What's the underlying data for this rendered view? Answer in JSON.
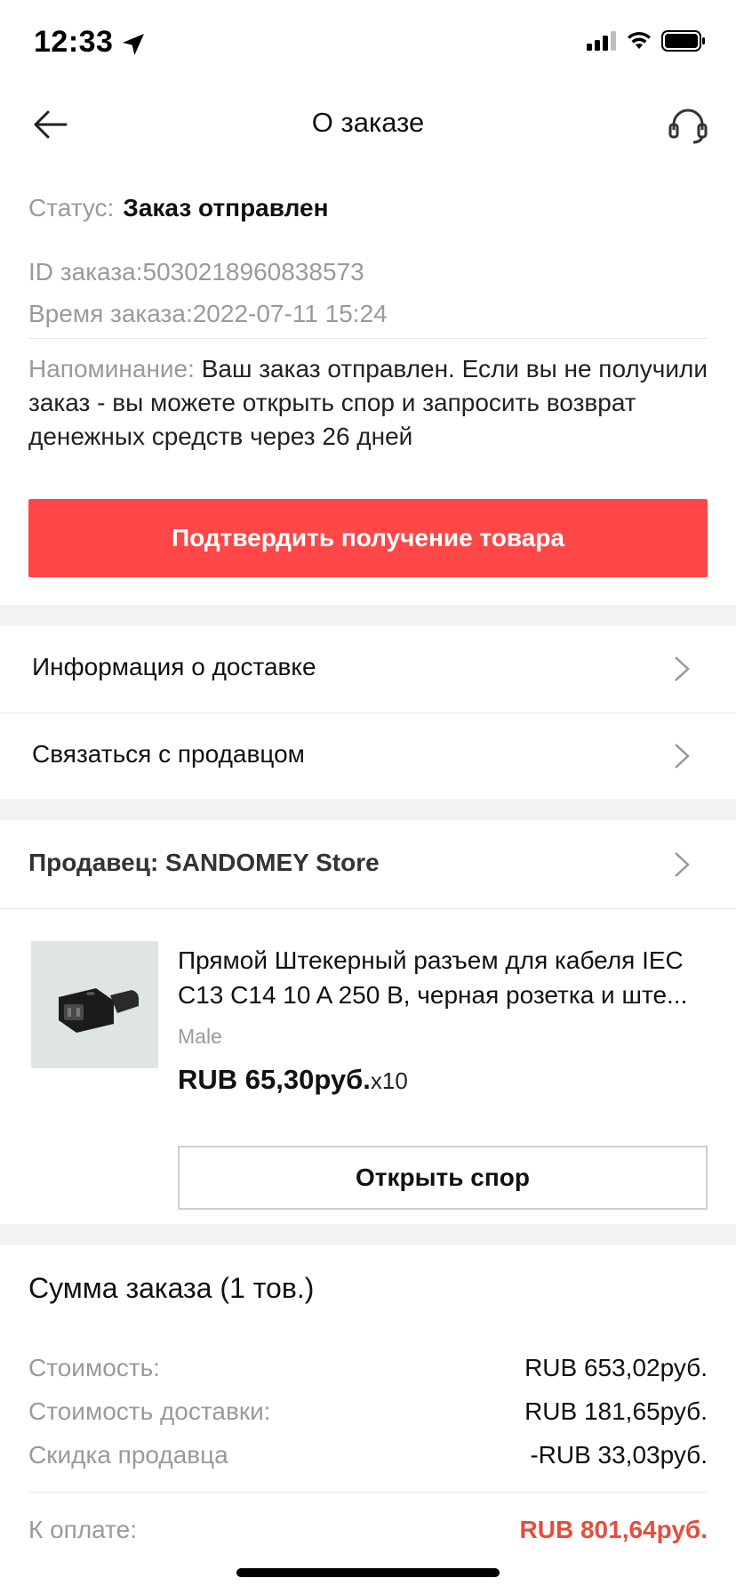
{
  "status_bar": {
    "time": "12:33",
    "icons": [
      "location-arrow-icon",
      "signal-icon",
      "wifi-icon",
      "battery-icon"
    ]
  },
  "nav": {
    "title": "О заказе",
    "back_icon": "back-arrow-icon",
    "support_icon": "headset-icon"
  },
  "order": {
    "status_label": "Статус:",
    "status_value": "Заказ отправлен",
    "id_line": "ID заказа:5030218960838573",
    "time_line": "Время заказа:2022-07-11 15:24",
    "reminder_label": "Напоминание:",
    "reminder_text": " Ваш заказ отправлен. Если вы не получили заказ - вы можете открыть спор и запросить возврат денежных средств через 26 дней",
    "confirm_button": "Подтвердить получение товара"
  },
  "menu": {
    "delivery_info": "Информация о доставке",
    "contact_seller": "Связаться с продавцом"
  },
  "seller": {
    "label": "Продавец: SANDOMEY Store"
  },
  "product": {
    "title": "Прямой Штекерный разъем для кабеля IEC C13 C14 10 A 250 В, черная розетка и ште...",
    "variant": "Male",
    "price": "RUB 65,30руб.",
    "quantity": "x10",
    "dispute_button": "Открыть спор"
  },
  "summary": {
    "title": "Сумма заказа (1 тов.)",
    "rows": [
      {
        "label": "Стоимость:",
        "value": "RUB 653,02руб."
      },
      {
        "label": "Стоимость доставки:",
        "value": "RUB 181,65руб."
      },
      {
        "label": "Скидка продавца",
        "value": "-RUB 33,03руб."
      }
    ],
    "total_label": "К оплате:",
    "total_value": "RUB 801,64руб."
  },
  "colors": {
    "accent": "#ff4747",
    "total": "#e74c3c",
    "muted_text": "#9a9a9a",
    "band": "#f2f2f2"
  }
}
